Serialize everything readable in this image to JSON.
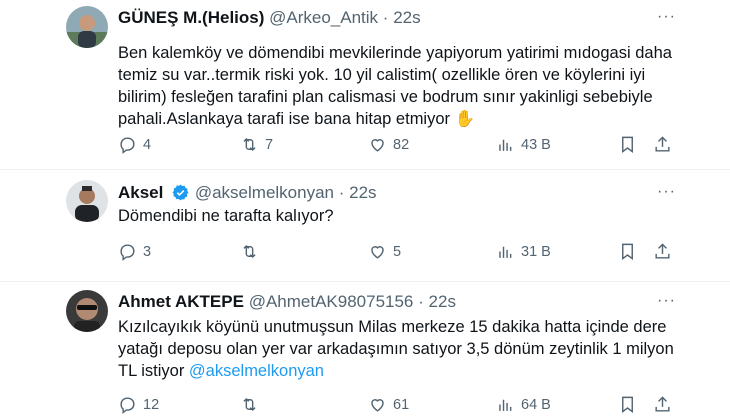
{
  "tweets": [
    {
      "display_name": "GÜNEŞ M.(Helios)",
      "handle": "@Arkeo_Antik",
      "sep": "·",
      "time": "22s",
      "more": "···",
      "text": "Ben kalemköy ve dömendibi mevkilerinde yapiyorum yatirimi mıdogasi daha temiz su var..termik riski yok. 10 yil calistim( ozellikle ören ve köylerini iyi bilirim) fesleğen tarafini plan calismasi ve bodrum sınır  yakinligi sebebiyle pahali.Aslankaya tarafi ise bana hitap etmiyor",
      "emoji": "✋",
      "replies": "4",
      "retweets": "7",
      "likes": "82",
      "views": "43 B"
    },
    {
      "display_name": "Aksel",
      "handle": "@akselmelkonyan",
      "sep": "·",
      "time": "22s",
      "more": "···",
      "text": "Dömendibi ne tarafta kalıyor?",
      "replies": "3",
      "retweets": "",
      "likes": "5",
      "views": "31 B"
    },
    {
      "display_name": "Ahmet AKTEPE",
      "handle": "@AhmetAK98075156",
      "sep": "·",
      "time": "22s",
      "more": "···",
      "text": "Kızılcayıkık köyünü unutmuşsun Milas merkeze 15 dakika hatta içinde dere yatağı deposu olan yer var arkadaşımın satıyor 3,5 dönüm zeytinlik 1 milyon TL istiyor",
      "mention": "@akselmelkonyan",
      "replies": "12",
      "retweets": "",
      "likes": "61",
      "views": "64 B"
    }
  ],
  "colors": {
    "text": "#0f1419",
    "secondary": "#536471",
    "accent": "#1d9bf0",
    "divider": "#eff3f4"
  },
  "icons": [
    "reply-icon",
    "retweet-icon",
    "like-icon",
    "views-icon",
    "bookmark-icon",
    "share-icon",
    "verified-badge-icon",
    "more-icon"
  ]
}
